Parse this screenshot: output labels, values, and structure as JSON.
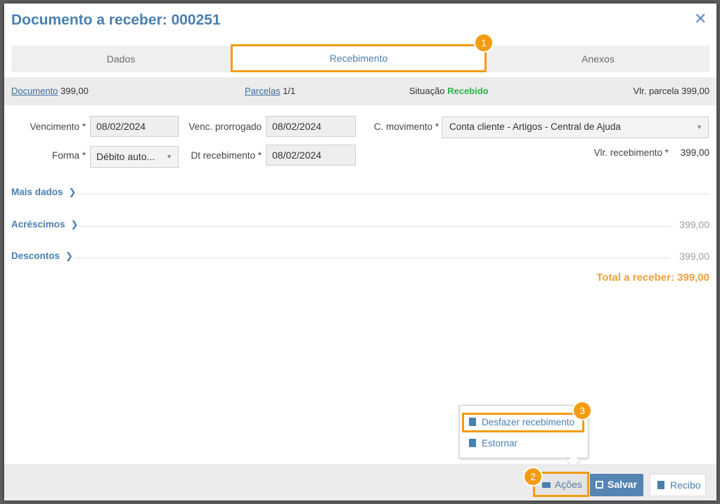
{
  "modal": {
    "title": "Documento a receber: 000251",
    "close_glyph": "✕"
  },
  "tabs": [
    {
      "label": "Dados"
    },
    {
      "label": "Recebimento"
    },
    {
      "label": "Anexos"
    }
  ],
  "badges": {
    "one": "1",
    "two": "2",
    "three": "3"
  },
  "summary": {
    "documento_label": "Documento",
    "documento_value": "399,00",
    "parcelas_label": "Parcelas",
    "parcelas_value": "1/1",
    "situacao_label": "Situação",
    "situacao_value": "Recebido",
    "vlr_parcela_label": "Vlr. parcela",
    "vlr_parcela_value": "399,00"
  },
  "form": {
    "vencimento_label": "Vencimento *",
    "vencimento_value": "08/02/2024",
    "venc_prorrogado_label": "Venc. prorrogado",
    "venc_prorrogado_value": "08/02/2024",
    "c_movimento_label": "C. movimento *",
    "c_movimento_value": "Conta cliente - Artigos - Central de Ajuda",
    "forma_label": "Forma *",
    "forma_value": "Débito auto...",
    "dt_recebimento_label": "Dt recebimento *",
    "dt_recebimento_value": "08/02/2024",
    "vlr_recebimento_label": "Vlr. recebimento *",
    "vlr_recebimento_value": "399,00"
  },
  "sections": {
    "mais_dados": "Mais dados",
    "acrescimos": "Acréscimos",
    "acrescimos_value": "399,00",
    "descontos": "Descontos",
    "descontos_value": "399,00"
  },
  "total": {
    "label": "Total a receber: 399,00"
  },
  "menu": {
    "desfazer": "Desfazer recebimento",
    "estornar": "Estornar"
  },
  "footer": {
    "acoes": "Ações",
    "salvar": "Salvar",
    "recibo": "Recibo"
  },
  "colors": {
    "accent": "#4a7fb0",
    "highlight": "#f39c12",
    "success": "#2db34a",
    "total": "#f0a03c"
  }
}
